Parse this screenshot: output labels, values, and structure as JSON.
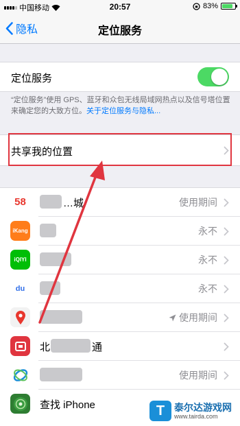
{
  "status_bar": {
    "carrier": "中国移动",
    "time": "20:57",
    "battery": "83%"
  },
  "nav": {
    "back_label": "隐私",
    "title": "定位服务"
  },
  "location_services": {
    "label": "定位服务",
    "enabled": true
  },
  "footnote": {
    "text": "“定位服务”使用 GPS、蓝牙和众包无线局域网热点以及信号塔位置来确定您的大致方位。",
    "link": "关于定位服务与隐私..."
  },
  "share_location": {
    "label": "共享我的位置"
  },
  "apps": [
    {
      "name": "58",
      "icon": "58-icon",
      "color": "#ffffff",
      "text_color": "#e8372e",
      "partial_name": "…城",
      "status": "使用期间",
      "arrow": false
    },
    {
      "name": "",
      "icon": "ikang-icon",
      "icon_label": "iKang",
      "color": "#ff7d1a",
      "partial_name": "",
      "status": "永不",
      "arrow": false
    },
    {
      "name": "",
      "icon": "iqiyi-icon",
      "icon_label": "iQIYI",
      "color": "#00be06",
      "partial_name": "",
      "status": "永不",
      "arrow": false
    },
    {
      "name": "",
      "icon": "baidu-icon",
      "icon_label": "du",
      "color": "#ffffff",
      "text_color": "#2f6ee9",
      "partial_name": "",
      "status": "永不",
      "arrow": false
    },
    {
      "name": "",
      "icon": "maps-icon",
      "color": "#f2f2f2",
      "partial_name": "",
      "status": "使用期间",
      "arrow": true
    },
    {
      "name": "北",
      "icon": "bjmt-icon",
      "color": "#e0353f",
      "partial_name": "通",
      "status": "",
      "arrow": false
    },
    {
      "name": "",
      "icon": "china-mobile-icon",
      "color": "#ffffff",
      "partial_name": "",
      "status": "使用期间",
      "arrow": false
    },
    {
      "name": "查找 iPhone",
      "icon": "find-iphone-icon",
      "color": "#3a9b40",
      "partial_name": "",
      "status": "",
      "arrow": false
    }
  ],
  "watermark": {
    "brand": "泰尔达游戏网",
    "url": "www.tairda.com",
    "logo_letter": "T"
  },
  "colors": {
    "accent": "#007aff",
    "toggle_on": "#4cd964",
    "highlight": "#e0353f"
  }
}
